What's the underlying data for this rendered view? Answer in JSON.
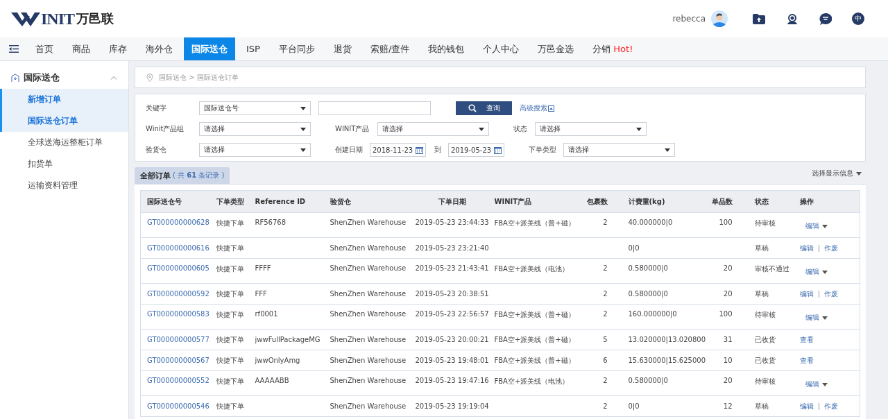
{
  "header": {
    "logo": {
      "text": "INIT",
      "subtitle": "万邑联"
    },
    "user": "rebecca",
    "language": "中"
  },
  "nav": {
    "items": [
      {
        "label": "首页",
        "selected": false
      },
      {
        "label": "商品",
        "selected": false
      },
      {
        "label": "库存",
        "selected": false
      },
      {
        "label": "海外仓",
        "selected": false
      },
      {
        "label": "国际送仓",
        "selected": true
      },
      {
        "label": "ISP",
        "selected": false
      },
      {
        "label": "平台同步",
        "selected": false
      },
      {
        "label": "退货",
        "selected": false
      },
      {
        "label": "索赔/查件",
        "selected": false
      },
      {
        "label": "我的钱包",
        "selected": false
      },
      {
        "label": "个人中心",
        "selected": false
      },
      {
        "label": "万邑金选",
        "selected": false
      },
      {
        "label": "分销",
        "selected": false,
        "badge": "Hot!"
      }
    ]
  },
  "sidebar": {
    "title": "国际送仓",
    "expanded": true,
    "items": [
      {
        "label": "新增订单",
        "selected": true
      },
      {
        "label": "国际送仓订单",
        "selected": true
      },
      {
        "label": "全球送海运整柜订单",
        "selected": false
      },
      {
        "label": "扣货单",
        "selected": false
      },
      {
        "label": "运输资料管理",
        "selected": false
      }
    ]
  },
  "breadcrumb": "国际送仓 > 国际送仓订单",
  "filters": [
    [
      {
        "kind": "select",
        "label": "关键字",
        "value": "国际送仓号"
      },
      {
        "kind": "input"
      },
      {
        "kind": "button",
        "label": "查询"
      },
      {
        "kind": "link",
        "label": "高级搜索"
      }
    ],
    [
      {
        "kind": "select",
        "label": "Winit产品组",
        "value": "请选择"
      },
      {
        "kind": "select",
        "label": "WINIT产品",
        "value": "请选择"
      },
      {
        "kind": "select",
        "label": "状态",
        "value": "请选择"
      }
    ],
    [
      {
        "kind": "select",
        "label": "验货仓",
        "value": "请选择"
      },
      {
        "kind": "daterange",
        "label": "创建日期",
        "from": "2018-11-23",
        "to_label": "到",
        "to": "2019-05-23"
      },
      {
        "kind": "select",
        "label": "下单类型",
        "value": "请选择"
      }
    ]
  ],
  "orders_tab": {
    "label": "全部订单",
    "count": "( 共 **61** 条记录 )",
    "display_options": "选择显示信息"
  },
  "table": {
    "columns": [
      "国际送仓号",
      "下单类型",
      "Reference ID",
      "验货仓",
      "下单日期",
      "WINIT产品",
      "包裹数",
      "计费重(kg)",
      "单品数",
      "状态",
      "操作"
    ],
    "rows": [
      {
        "id": "GT000000000628",
        "type": "快捷下单",
        "ref": "RF56768",
        "warehouse": "ShenZhen Warehouse",
        "date": "2019-05-23 23:44:33",
        "product": "FBA空+派美线（普+磁）",
        "packages": "2",
        "weight": "40.000000|0",
        "items": "100",
        "status": "待审核",
        "actions": [
          "编辑"
        ],
        "dropdown": true
      },
      {
        "id": "GT000000000616",
        "type": "快捷下单",
        "warehouse": "ShenZhen Warehouse",
        "date": "2019-05-23 23:21:40",
        "weight": "0|0",
        "status": "草稿",
        "actions": [
          "编辑",
          "作废"
        ],
        "dropdown": false
      },
      {
        "id": "GT000000000605",
        "type": "快捷下单",
        "ref": "FFFF",
        "warehouse": "ShenZhen Warehouse",
        "date": "2019-05-23 21:43:41",
        "product": "FBA空+派美线（电池）",
        "packages": "2",
        "weight": "0.580000|0",
        "items": "20",
        "status": "审核不通过",
        "actions": [
          "编辑"
        ],
        "dropdown": true
      },
      {
        "id": "GT000000000592",
        "type": "快捷下单",
        "ref": "FFF",
        "warehouse": "ShenZhen Warehouse",
        "date": "2019-05-23 20:38:51",
        "packages": "2",
        "weight": "0.580000|0",
        "items": "20",
        "status": "草稿",
        "actions": [
          "编辑",
          "作废"
        ],
        "dropdown": false
      },
      {
        "id": "GT000000000583",
        "type": "快捷下单",
        "ref": "rf0001",
        "warehouse": "ShenZhen Warehouse",
        "date": "2019-05-23 22:56:57",
        "product": "FBA空+派美线（普+磁）",
        "packages": "2",
        "weight": "160.000000|0",
        "items": "100",
        "status": "待审核",
        "actions": [
          "编辑"
        ],
        "dropdown": true
      },
      {
        "id": "GT000000000577",
        "type": "快捷下单",
        "ref": "jwwFullPackageMG",
        "warehouse": "ShenZhen Warehouse",
        "date": "2019-05-23 20:00:21",
        "product": "FBA空+派美线（普+磁）",
        "packages": "5",
        "weight": "13.020000|13.020800",
        "items": "31",
        "status": "已收货",
        "actions": [
          "查看"
        ],
        "dropdown": false
      },
      {
        "id": "GT000000000567",
        "type": "快捷下单",
        "ref": "jwwOnlyAmg",
        "warehouse": "ShenZhen Warehouse",
        "date": "2019-05-23 19:48:01",
        "product": "FBA空+派美线（普+磁）",
        "packages": "6",
        "weight": "15.630000|15.625000",
        "items": "10",
        "status": "已收货",
        "actions": [
          "查看"
        ],
        "dropdown": false
      },
      {
        "id": "GT000000000552",
        "type": "快捷下单",
        "ref": "AAAAABB",
        "warehouse": "ShenZhen Warehouse",
        "date": "2019-05-23 19:47:16",
        "product": "FBA空+派美线（电池）",
        "packages": "2",
        "weight": "0.580000|0",
        "items": "20",
        "status": "待审核",
        "actions": [
          "编辑"
        ],
        "dropdown": true
      },
      {
        "id": "GT000000000546",
        "type": "快捷下单",
        "warehouse": "ShenZhen Warehouse",
        "date": "2019-05-23 19:19:04",
        "packages": "2",
        "weight": "0|0",
        "items": "12",
        "status": "草稿",
        "actions": [
          "编辑",
          "作废"
        ],
        "dropdown": false
      }
    ]
  }
}
